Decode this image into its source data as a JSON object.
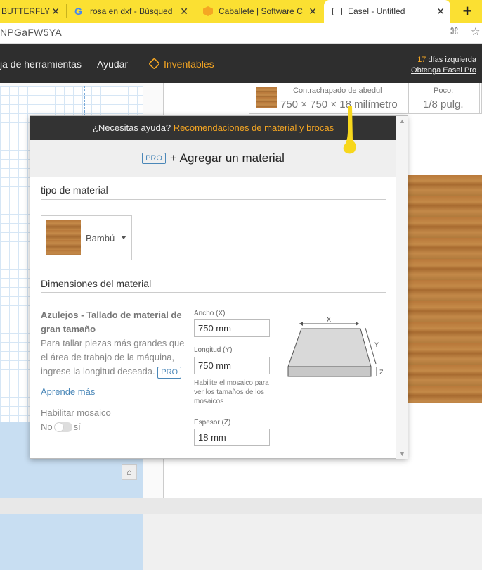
{
  "browser": {
    "tabs": [
      {
        "label": "BUTTERFLY"
      },
      {
        "label": "rosa en dxf - Búsqued"
      },
      {
        "label": "Caballete | Software C"
      },
      {
        "label": "Easel - Untitled"
      }
    ],
    "new_tab": "+",
    "url": "NPGaFW5YA",
    "colors": {
      "tabbar": "#fbe032"
    }
  },
  "app_header": {
    "menu_toolbox": "ja de herramientas",
    "menu_help": "Ayudar",
    "menu_inventables": "Inventables",
    "trial_days": "17",
    "trial_text": "días izquierda",
    "trial_link": "Obtenga Easel Pro"
  },
  "material_bar": {
    "material_name": "Contrachapado de abedul",
    "material_size": "750 × 750 × 18 milímetro",
    "bit_label": "Poco:",
    "bit_value": "1/8 pulg."
  },
  "modal": {
    "help_text": "¿Necesitas ayuda?",
    "help_link": "Recomendaciones de material y brocas",
    "pro_badge": "PRO",
    "add_material": "+ Agregar un material",
    "material_type_title": "tipo de material",
    "material_type_value": "Bambú",
    "dimensions_title": "Dimensiones del material",
    "tiling_heading": "Azulejos - Tallado de material de gran tamaño",
    "tiling_desc": "Para tallar piezas más grandes que el área de trabajo de la máquina, ingrese la longitud deseada.",
    "tiling_pro_badge": "PRO",
    "learn_more": "Aprende más",
    "enable_tiling": "Habilitar mosaico",
    "toggle_no": "No",
    "toggle_yes": "sí",
    "width_label": "Ancho (X)",
    "width_value": "750 mm",
    "length_label": "Longitud (Y)",
    "length_value": "750 mm",
    "tile_hint": "Habilite el mosaico para ver los tamaños de los mosaicos",
    "thickness_label": "Espesor (Z)",
    "thickness_value": "18 mm",
    "diagram_x": "X",
    "diagram_y": "Y",
    "diagram_z": "Z",
    "accent_color": "#f5a623",
    "link_color": "#4a87b8"
  }
}
